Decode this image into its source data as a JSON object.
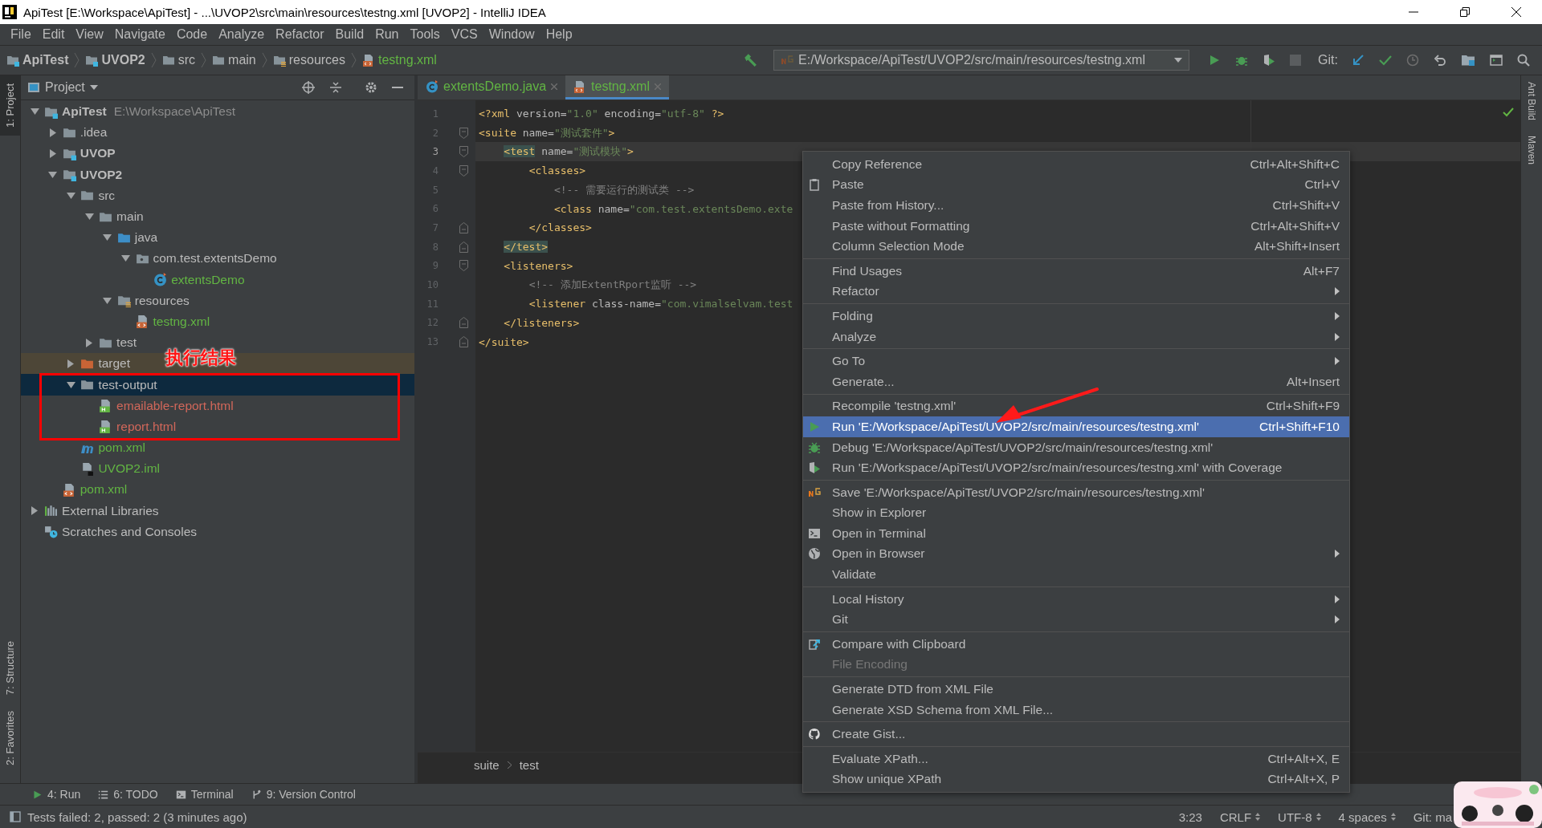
{
  "window": {
    "title": "ApiTest [E:\\Workspace\\ApiTest] - ...\\UVOP2\\src\\main\\resources\\testng.xml [UVOP2] - IntelliJ IDEA"
  },
  "menu_bar": [
    "File",
    "Edit",
    "View",
    "Navigate",
    "Code",
    "Analyze",
    "Refactor",
    "Build",
    "Run",
    "Tools",
    "VCS",
    "Window",
    "Help"
  ],
  "nav_bar": {
    "breadcrumbs": [
      {
        "label": "ApiTest",
        "kind": "module",
        "bold": true,
        "color": "#bbbbbb"
      },
      {
        "label": "UVOP2",
        "kind": "module",
        "bold": true,
        "color": "#bbbbbb"
      },
      {
        "label": "src",
        "kind": "folder",
        "bold": false,
        "color": "#bbbbbb"
      },
      {
        "label": "main",
        "kind": "folder",
        "bold": false,
        "color": "#bbbbbb"
      },
      {
        "label": "resources",
        "kind": "resources",
        "bold": false,
        "color": "#bbbbbb"
      },
      {
        "label": "testng.xml",
        "kind": "xml",
        "bold": false,
        "color": "#62b543"
      }
    ],
    "run_config": "E:/Workspace/ApiTest/UVOP2/src/main/resources/testng.xml",
    "git_label": "Git:"
  },
  "left_stripe_top": [
    {
      "label": "1: Project",
      "selected": true
    }
  ],
  "left_stripe_bottom": [
    {
      "label": "7: Structure",
      "selected": false
    },
    {
      "label": "2: Favorites",
      "selected": false
    }
  ],
  "right_stripe": [
    "Ant Build",
    "Maven"
  ],
  "project_panel": {
    "title": "Project",
    "tree": [
      {
        "label": "ApiTest",
        "hint": "E:\\Workspace\\ApiTest",
        "kind": "module",
        "bold": true,
        "color": "#bbbbbb",
        "selected": false,
        "expanded": true,
        "children": [
          {
            "label": ".idea",
            "kind": "folder",
            "bold": false,
            "color": "#bbbbbb",
            "selected": false,
            "expanded": false
          },
          {
            "label": "UVOP",
            "kind": "module",
            "bold": true,
            "color": "#bbbbbb",
            "selected": false,
            "expanded": false
          },
          {
            "label": "UVOP2",
            "kind": "module",
            "bold": true,
            "color": "#bbbbbb",
            "selected": false,
            "expanded": true,
            "children": [
              {
                "label": "src",
                "kind": "folder",
                "bold": false,
                "color": "#bbbbbb",
                "selected": false,
                "expanded": true,
                "children": [
                  {
                    "label": "main",
                    "kind": "folder",
                    "bold": false,
                    "color": "#bbbbbb",
                    "selected": false,
                    "expanded": true,
                    "children": [
                      {
                        "label": "java",
                        "kind": "sources",
                        "bold": false,
                        "color": "#bbbbbb",
                        "selected": false,
                        "expanded": true,
                        "children": [
                          {
                            "label": "com.test.extentsDemo",
                            "kind": "package",
                            "bold": false,
                            "color": "#bbbbbb",
                            "selected": false,
                            "expanded": true,
                            "children": [
                              {
                                "label": "extentsDemo",
                                "kind": "class",
                                "bold": false,
                                "color": "#62b543",
                                "selected": false
                              }
                            ]
                          }
                        ]
                      },
                      {
                        "label": "resources",
                        "kind": "resources",
                        "bold": false,
                        "color": "#bbbbbb",
                        "selected": false,
                        "expanded": true,
                        "children": [
                          {
                            "label": "testng.xml",
                            "kind": "xml",
                            "bold": false,
                            "color": "#62b543",
                            "selected": false
                          }
                        ]
                      }
                    ]
                  },
                  {
                    "label": "test",
                    "kind": "folder",
                    "bold": false,
                    "color": "#bbbbbb",
                    "selected": false,
                    "expanded": false
                  }
                ]
              },
              {
                "label": "target",
                "kind": "excluded",
                "bold": false,
                "color": "#bbbbbb",
                "selected": false,
                "expanded": false
              },
              {
                "label": "test-output",
                "kind": "folder",
                "bold": false,
                "color": "#bbbbbb",
                "selected": true,
                "expanded": true,
                "children": [
                  {
                    "label": "emailable-report.html",
                    "kind": "html",
                    "bold": false,
                    "color": "#d1675a",
                    "selected": false
                  },
                  {
                    "label": "report.html",
                    "kind": "html",
                    "bold": false,
                    "color": "#d1675a",
                    "selected": false
                  }
                ]
              },
              {
                "label": "pom.xml",
                "kind": "maven",
                "bold": false,
                "color": "#62b543",
                "selected": false
              },
              {
                "label": "UVOP2.iml",
                "kind": "iml",
                "bold": false,
                "color": "#62b543",
                "selected": false
              }
            ]
          },
          {
            "label": "pom.xml",
            "kind": "xml",
            "bold": false,
            "color": "#62b543",
            "selected": false
          }
        ]
      },
      {
        "label": "External Libraries",
        "kind": "libraries",
        "bold": false,
        "color": "#bbbbbb",
        "selected": false,
        "expanded": false
      },
      {
        "label": "Scratches and Consoles",
        "kind": "scratches",
        "bold": false,
        "color": "#bbbbbb",
        "selected": false
      }
    ]
  },
  "annotation": {
    "label": "执行结果"
  },
  "editor": {
    "tabs": [
      {
        "label": "extentsDemo.java",
        "kind": "class",
        "selected": false
      },
      {
        "label": "testng.xml",
        "kind": "xml",
        "selected": true
      }
    ],
    "lines": [
      {
        "number": "1",
        "current": false,
        "fold_start": false,
        "fold_end": false,
        "segments": [
          {
            "kind": "tag",
            "text": "<?xml "
          },
          {
            "kind": "attr",
            "text": "version="
          },
          {
            "kind": "val",
            "text": "\"1.0\""
          },
          {
            "kind": "attr",
            "text": " encoding="
          },
          {
            "kind": "val",
            "text": "\"utf-8\""
          },
          {
            "kind": "tag",
            "text": " ?>"
          }
        ]
      },
      {
        "number": "2",
        "current": false,
        "fold_start": true,
        "fold_end": false,
        "segments": [
          {
            "kind": "tag",
            "text": "<suite"
          },
          {
            "kind": "attr",
            "text": " name="
          },
          {
            "kind": "val",
            "text": "\"测试套件\""
          },
          {
            "kind": "tag",
            "text": ">"
          }
        ]
      },
      {
        "number": "3",
        "current": true,
        "fold_start": true,
        "fold_end": false,
        "segments": [
          {
            "kind": "tag",
            "text": "    <test",
            "match": true
          },
          {
            "kind": "attr",
            "text": " name="
          },
          {
            "kind": "val",
            "text": "\"测试模块\""
          },
          {
            "kind": "tag",
            "text": ">"
          }
        ]
      },
      {
        "number": "4",
        "current": false,
        "fold_start": true,
        "fold_end": false,
        "segments": [
          {
            "kind": "tag",
            "text": "        <classes>"
          }
        ]
      },
      {
        "number": "5",
        "current": false,
        "fold_start": false,
        "fold_end": false,
        "segments": [
          {
            "kind": "cmt",
            "text": "            <!-- 需要运行的测试类 -->"
          }
        ]
      },
      {
        "number": "6",
        "current": false,
        "fold_start": false,
        "fold_end": false,
        "segments": [
          {
            "kind": "tag",
            "text": "            <class"
          },
          {
            "kind": "attr",
            "text": " name="
          },
          {
            "kind": "val",
            "text": "\"com.test.extentsDemo.exte"
          }
        ]
      },
      {
        "number": "7",
        "current": false,
        "fold_start": false,
        "fold_end": true,
        "segments": [
          {
            "kind": "tag",
            "text": "        </classes>"
          }
        ]
      },
      {
        "number": "8",
        "current": false,
        "fold_start": false,
        "fold_end": true,
        "segments": [
          {
            "kind": "tag",
            "text": "    </test>",
            "match": true
          }
        ]
      },
      {
        "number": "9",
        "current": false,
        "fold_start": true,
        "fold_end": false,
        "segments": [
          {
            "kind": "tag",
            "text": "    <listeners>"
          }
        ]
      },
      {
        "number": "10",
        "current": false,
        "fold_start": false,
        "fold_end": false,
        "segments": [
          {
            "kind": "cmt",
            "text": "        <!-- 添加ExtentRport监听 -->"
          }
        ]
      },
      {
        "number": "11",
        "current": false,
        "fold_start": false,
        "fold_end": false,
        "segments": [
          {
            "kind": "tag",
            "text": "        <listener"
          },
          {
            "kind": "attr",
            "text": " class-name="
          },
          {
            "kind": "val",
            "text": "\"com.vimalselvam.test"
          }
        ]
      },
      {
        "number": "12",
        "current": false,
        "fold_start": false,
        "fold_end": true,
        "segments": [
          {
            "kind": "tag",
            "text": "    </listeners>"
          }
        ]
      },
      {
        "number": "13",
        "current": false,
        "fold_start": false,
        "fold_end": true,
        "segments": [
          {
            "kind": "tag",
            "text": "</suite>"
          }
        ]
      }
    ],
    "breadcrumbs": [
      "suite",
      "test"
    ]
  },
  "context_menu": {
    "groups": [
      [
        {
          "label": "Copy Reference",
          "shortcut": "Ctrl+Alt+Shift+C",
          "kind": "plain",
          "submenu": false,
          "selected": false,
          "disabled": false
        },
        {
          "label": "Paste",
          "shortcut": "Ctrl+V",
          "kind": "clipboard",
          "submenu": false,
          "selected": false,
          "disabled": false
        },
        {
          "label": "Paste from History...",
          "shortcut": "Ctrl+Shift+V",
          "kind": "plain",
          "submenu": false,
          "selected": false,
          "disabled": false
        },
        {
          "label": "Paste without Formatting",
          "shortcut": "Ctrl+Alt+Shift+V",
          "kind": "plain",
          "submenu": false,
          "selected": false,
          "disabled": false
        },
        {
          "label": "Column Selection Mode",
          "shortcut": "Alt+Shift+Insert",
          "kind": "plain",
          "submenu": false,
          "selected": false,
          "disabled": false
        }
      ],
      [
        {
          "label": "Find Usages",
          "shortcut": "Alt+F7",
          "kind": "plain",
          "submenu": false,
          "selected": false,
          "disabled": false
        },
        {
          "label": "Refactor",
          "kind": "plain",
          "submenu": true,
          "selected": false,
          "disabled": false
        }
      ],
      [
        {
          "label": "Folding",
          "kind": "plain",
          "submenu": true,
          "selected": false,
          "disabled": false
        },
        {
          "label": "Analyze",
          "kind": "plain",
          "submenu": true,
          "selected": false,
          "disabled": false
        }
      ],
      [
        {
          "label": "Go To",
          "kind": "plain",
          "submenu": true,
          "selected": false,
          "disabled": false
        },
        {
          "label": "Generate...",
          "shortcut": "Alt+Insert",
          "kind": "plain",
          "submenu": false,
          "selected": false,
          "disabled": false
        }
      ],
      [
        {
          "label": "Recompile 'testng.xml'",
          "shortcut": "Ctrl+Shift+F9",
          "kind": "plain",
          "submenu": false,
          "selected": false,
          "disabled": false
        },
        {
          "label": "Run 'E:/Workspace/ApiTest/UVOP2/src/main/resources/testng.xml'",
          "shortcut": "Ctrl+Shift+F10",
          "kind": "run",
          "submenu": false,
          "selected": true,
          "disabled": false
        },
        {
          "label": "Debug 'E:/Workspace/ApiTest/UVOP2/src/main/resources/testng.xml'",
          "kind": "debug",
          "submenu": false,
          "selected": false,
          "disabled": false
        },
        {
          "label": "Run 'E:/Workspace/ApiTest/UVOP2/src/main/resources/testng.xml' with Coverage",
          "kind": "coverage",
          "submenu": false,
          "selected": false,
          "disabled": false
        }
      ],
      [
        {
          "label": "Save 'E:/Workspace/ApiTest/UVOP2/src/main/resources/testng.xml'",
          "kind": "testng",
          "submenu": false,
          "selected": false,
          "disabled": false
        },
        {
          "label": "Show in Explorer",
          "kind": "plain",
          "submenu": false,
          "selected": false,
          "disabled": false
        },
        {
          "label": "Open in Terminal",
          "kind": "terminal",
          "submenu": false,
          "selected": false,
          "disabled": false
        },
        {
          "label": "Open in Browser",
          "kind": "globe",
          "submenu": true,
          "selected": false,
          "disabled": false
        },
        {
          "label": "Validate",
          "kind": "plain",
          "submenu": false,
          "selected": false,
          "disabled": false
        }
      ],
      [
        {
          "label": "Local History",
          "kind": "plain",
          "submenu": true,
          "selected": false,
          "disabled": false
        },
        {
          "label": "Git",
          "kind": "plain",
          "submenu": true,
          "selected": false,
          "disabled": false
        }
      ],
      [
        {
          "label": "Compare with Clipboard",
          "kind": "compare",
          "submenu": false,
          "selected": false,
          "disabled": false
        },
        {
          "label": "File Encoding",
          "kind": "plain",
          "submenu": false,
          "selected": false,
          "disabled": true
        }
      ],
      [
        {
          "label": "Generate DTD from XML File",
          "kind": "plain",
          "submenu": false,
          "selected": false,
          "disabled": false
        },
        {
          "label": "Generate XSD Schema from XML File...",
          "kind": "plain",
          "submenu": false,
          "selected": false,
          "disabled": false
        }
      ],
      [
        {
          "label": "Create Gist...",
          "kind": "github",
          "submenu": false,
          "selected": false,
          "disabled": false
        }
      ],
      [
        {
          "label": "Evaluate XPath...",
          "shortcut": "Ctrl+Alt+X, E",
          "kind": "plain",
          "submenu": false,
          "selected": false,
          "disabled": false
        },
        {
          "label": "Show unique XPath",
          "shortcut": "Ctrl+Alt+X, P",
          "kind": "plain",
          "submenu": false,
          "selected": false,
          "disabled": false
        }
      ]
    ]
  },
  "tool_windows": [
    {
      "label": "4: Run",
      "kind": "run"
    },
    {
      "label": "6: TODO",
      "kind": "list"
    },
    {
      "label": "Terminal",
      "kind": "terminal"
    },
    {
      "label": "9: Version Control",
      "kind": "branch"
    }
  ],
  "status_bar": {
    "message": "Tests failed: 2, passed: 2 (3 minutes ago)",
    "items": [
      {
        "label": "3:23",
        "dropdown": false
      },
      {
        "label": "CRLF",
        "dropdown": true
      },
      {
        "label": "UTF-8",
        "dropdown": true
      },
      {
        "label": "4 spaces",
        "dropdown": true
      },
      {
        "label": "Git: ma",
        "dropdown": false
      }
    ]
  }
}
